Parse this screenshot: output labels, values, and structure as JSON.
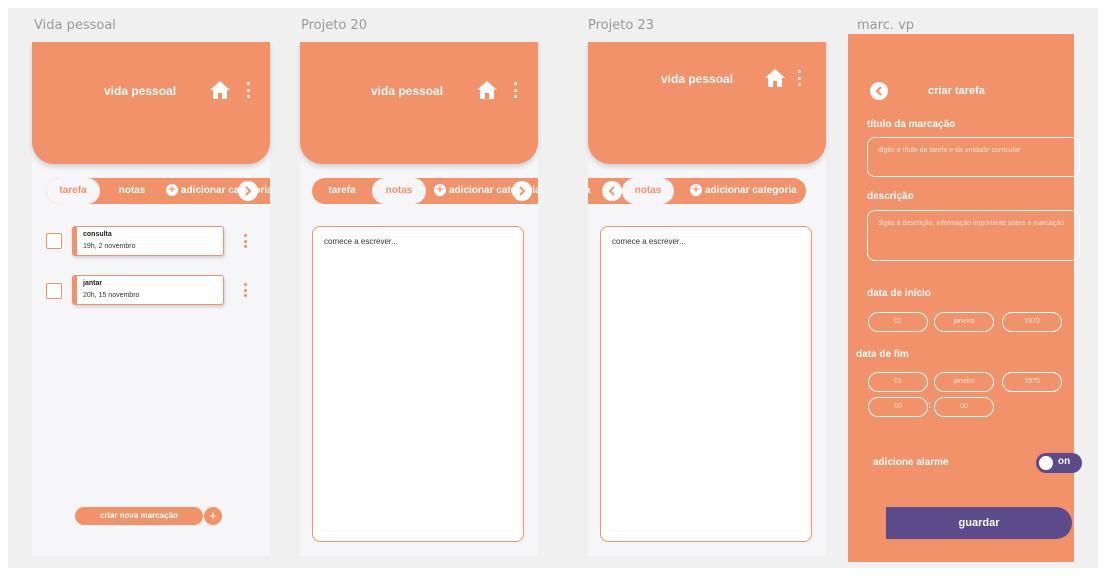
{
  "colors": {
    "accent": "#f2926a",
    "purple": "#5b4b8a",
    "background": "#f6f6f8"
  },
  "frames": [
    {
      "name": "Vida pessoal",
      "header_title": "vida pessoal",
      "tabs": [
        "tarefa",
        "notas"
      ],
      "add_category": "adicionar categoria",
      "tasks": [
        {
          "title": "consulta",
          "date": "19h, 2 novembro"
        },
        {
          "title": "jantar",
          "date": "20h, 15 novembro"
        }
      ],
      "create_button": "criar nova marcação"
    },
    {
      "name": "Projeto 20",
      "header_title": "vida pessoal",
      "tabs": [
        "tarefa",
        "notas"
      ],
      "add_category": "adicionar categoria",
      "notes_placeholder": "comece a escrever..."
    },
    {
      "name": "Projeto 23",
      "header_title": "vida pessoal",
      "tabs": [
        "tarefa",
        "notas"
      ],
      "add_category": "adicionar categoria",
      "notes_placeholder": "comece a escrever..."
    }
  ],
  "form": {
    "frame_name": "marc. vp",
    "title": "criar tarefa",
    "title_label": "título da marcação",
    "title_placeholder": "digite o título da tarefa e da unidade curricular",
    "description_label": "descrição",
    "description_placeholder": "digita a descrição, informação importante sobre a marcação",
    "start_label": "data de início",
    "start": {
      "day": "01",
      "month": "janeiro",
      "year": "1970"
    },
    "end_label": "data de fim",
    "end": {
      "day": "01",
      "month": "janeiro",
      "year": "1970",
      "hour": "00",
      "minute": "00"
    },
    "alarm_label": "adicione alarme",
    "alarm_state": "on",
    "save_label": "guardar"
  }
}
